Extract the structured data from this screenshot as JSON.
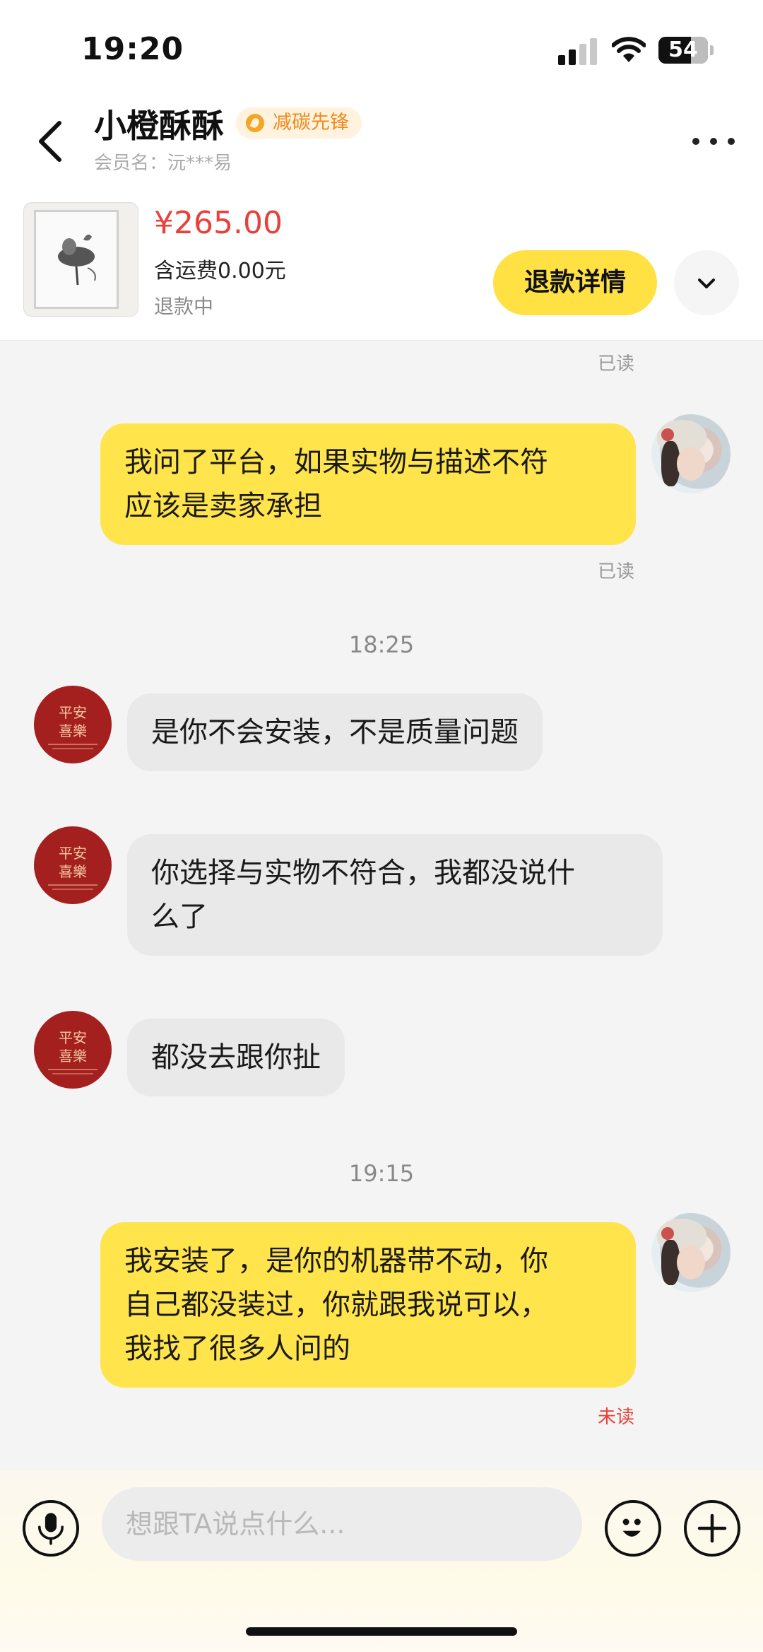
{
  "status_bar": {
    "time": "19:20",
    "battery": "54"
  },
  "header": {
    "title": "小橙酥酥",
    "badge": "减碳先锋",
    "member": "会员名：沅***易",
    "back_icon": "chevron-left-icon",
    "more_icon": "more-horizontal-icon"
  },
  "product": {
    "price": "¥265.00",
    "shipping": "含运费0.00元",
    "status": "退款中",
    "refund_button": "退款详情",
    "expand_icon": "chevron-down-icon"
  },
  "messages": {
    "read_top": "已读",
    "m1": {
      "lines": [
        "我问了平台，如果实物与描述不符",
        "应该是卖家承担"
      ],
      "status": "已读"
    },
    "time1": "18:25",
    "m2": {
      "text": "是你不会安装，不是质量问题"
    },
    "m3": {
      "lines": [
        "你选择与实物不符合，我都没说什",
        "么了"
      ]
    },
    "m4": {
      "text": "都没去跟你扯"
    },
    "time2": "19:15",
    "m5": {
      "lines": [
        "我安装了，是你的机器带不动，你",
        "自己都没装过，你就跟我说可以，",
        "我找了很多人问的"
      ],
      "status": "未读"
    },
    "shop_avatar": [
      "平安",
      "喜樂"
    ]
  },
  "input_bar": {
    "placeholder": "想跟TA说点什么...",
    "mic_icon": "microphone-icon",
    "emoji_icon": "emoji-icon",
    "plus_icon": "plus-icon"
  },
  "colors": {
    "accent_yellow": "#ffe44b",
    "price_red": "#e8413c",
    "badge_orange": "#f08a1c"
  }
}
